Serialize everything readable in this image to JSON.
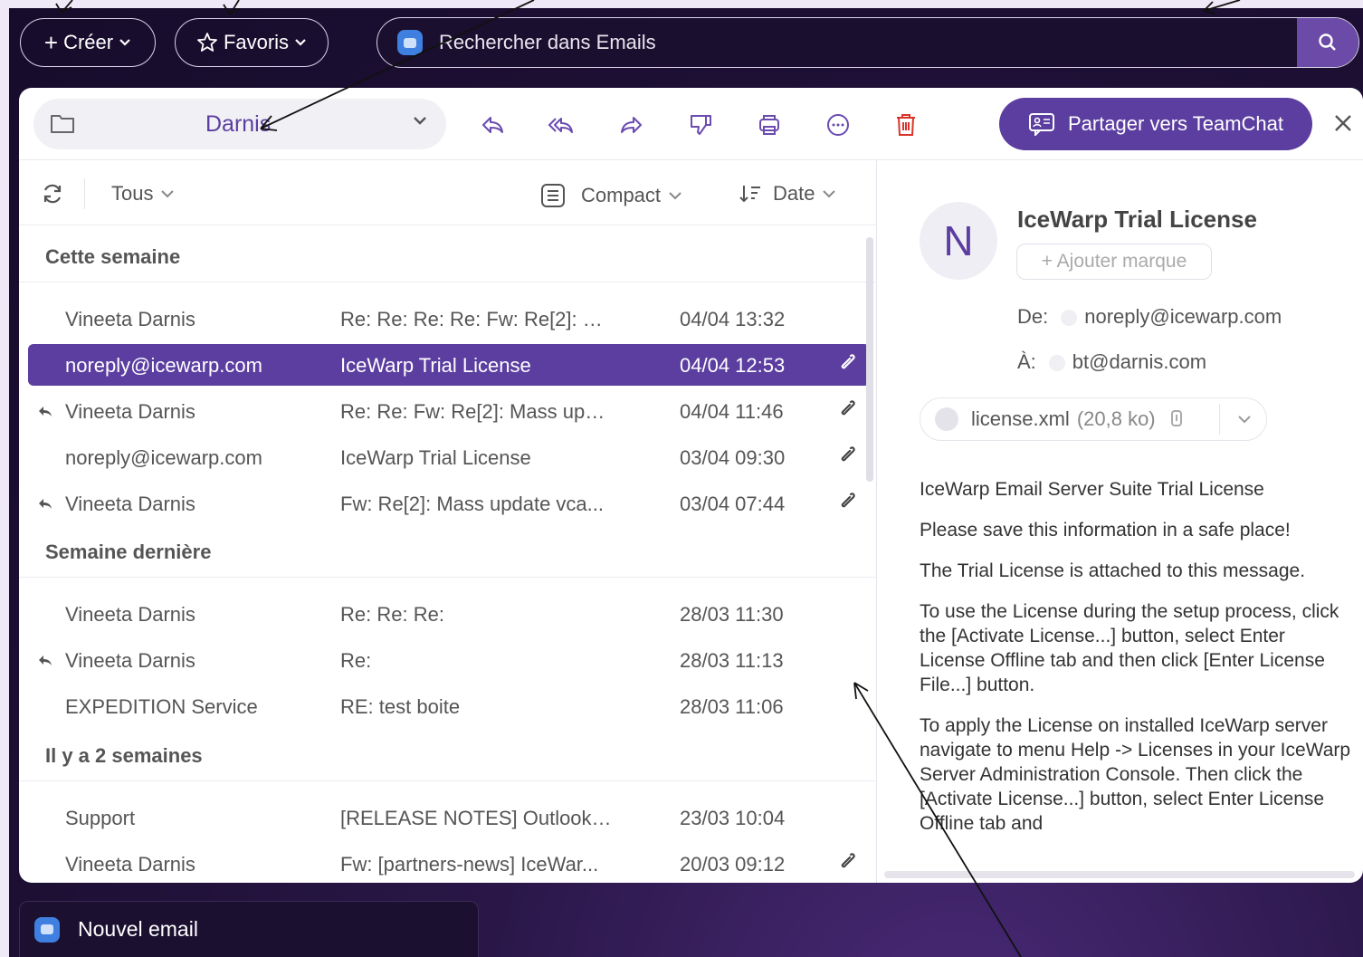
{
  "topbar": {
    "create_label": "Créer",
    "favorites_label": "Favoris",
    "search_placeholder": "Rechercher dans Emails"
  },
  "toolbar": {
    "folder_name": "Darnis",
    "share_label": "Partager vers TeamChat"
  },
  "list": {
    "filter_label": "Tous",
    "view_label": "Compact",
    "sort_label": "Date",
    "groups": [
      {
        "title": "Cette semaine"
      },
      {
        "title": "Semaine dernière"
      },
      {
        "title": "Il y a 2 semaines"
      }
    ],
    "rows": [
      {
        "sender": "Vineeta Darnis",
        "subject": "Re: Re: Re: Re: Fw: Re[2]: M...",
        "date": "04/04 13:32",
        "attachment": false,
        "replied": false,
        "selected": false
      },
      {
        "sender": "noreply@icewarp.com",
        "subject": "IceWarp Trial License",
        "date": "04/04 12:53",
        "attachment": true,
        "replied": false,
        "selected": true
      },
      {
        "sender": "Vineeta Darnis",
        "subject": "Re: Re: Fw: Re[2]: Mass upd...",
        "date": "04/04 11:46",
        "attachment": true,
        "replied": true,
        "selected": false
      },
      {
        "sender": "noreply@icewarp.com",
        "subject": "IceWarp Trial License",
        "date": "03/04 09:30",
        "attachment": true,
        "replied": false,
        "selected": false
      },
      {
        "sender": "Vineeta Darnis",
        "subject": "Fw: Re[2]: Mass update vca...",
        "date": "03/04 07:44",
        "attachment": true,
        "replied": true,
        "selected": false
      },
      {
        "sender": "Vineeta Darnis",
        "subject": "Re: Re: Re:",
        "date": "28/03 11:30",
        "attachment": false,
        "replied": false,
        "selected": false
      },
      {
        "sender": "Vineeta Darnis",
        "subject": "Re: ",
        "date": "28/03 11:13",
        "attachment": false,
        "replied": true,
        "selected": false
      },
      {
        "sender": "EXPEDITION Service",
        "subject": "RE: test boite",
        "date": "28/03 11:06",
        "attachment": false,
        "replied": false,
        "selected": false
      },
      {
        "sender": "Support",
        "subject": "[RELEASE NOTES] Outlook ...",
        "date": "23/03 10:04",
        "attachment": false,
        "replied": false,
        "selected": false
      },
      {
        "sender": "Vineeta Darnis",
        "subject": "Fw: [partners-news] IceWar...",
        "date": "20/03 09:12",
        "attachment": true,
        "replied": false,
        "selected": false
      }
    ]
  },
  "message": {
    "avatar_letter": "N",
    "title": "IceWarp Trial License",
    "add_tag_label": "+ Ajouter marque",
    "from_label": "De:",
    "from": "noreply@icewarp.com",
    "to_label": "À:",
    "to": "bt@darnis.com",
    "attachment_name": "license.xml",
    "attachment_size": "(20,8 ko)",
    "body": [
      "IceWarp Email Server Suite Trial License",
      "Please save this information in a safe place!",
      "The Trial License is attached to this message.",
      "To use the License during the setup process, click the [Activate License...] button, select Enter License Offline tab and then click [Enter License File...] button.",
      "To apply the License on installed IceWarp server navigate to menu Help -> Licenses in your IceWarp Server Administration Console. Then click the [Activate License...] button, select Enter License Offline tab and"
    ]
  },
  "footer": {
    "new_email_label": "Nouvel email"
  },
  "colors": {
    "accent": "#5b3ea0",
    "background": "#1c0f33",
    "search_button": "#6b4aa8"
  }
}
